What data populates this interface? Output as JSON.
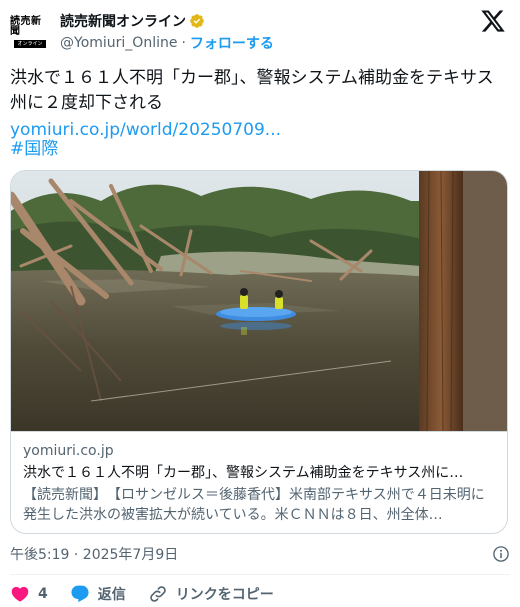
{
  "account": {
    "avatar_text": "読売新聞",
    "avatar_sub": "オンライン",
    "display_name": "読売新聞オンライン",
    "handle": "@Yomiuri_Online",
    "separator": "·",
    "follow_label": "フォローする"
  },
  "tweet": {
    "text": "洪水で１６１人不明「カー郡」、警報システム補助金をテキサス州に２度却下される",
    "link_text": "yomiuri.co.jp/world/20250709...",
    "hashtag": "#国際"
  },
  "card": {
    "domain": "yomiuri.co.jp",
    "title": "洪水で１６１人不明「カー郡」、警報システム補助金をテキサス州に…",
    "description": "【読売新聞】　【ロサンゼルス＝後藤香代】米南部テキサス州で４日未明に発生した洪水の被害拡大が続いている。米ＣＮＮは８日、州全体…"
  },
  "meta": {
    "timestamp": "午後5:19 · 2025年7月9日"
  },
  "actions": {
    "like_count": "4",
    "reply_label": "返信",
    "copy_link_label": "リンクをコピー"
  },
  "colors": {
    "accent": "#1d9bf0",
    "verified_gold": "#e2b719",
    "like_red": "#f91880",
    "muted": "#536471"
  }
}
